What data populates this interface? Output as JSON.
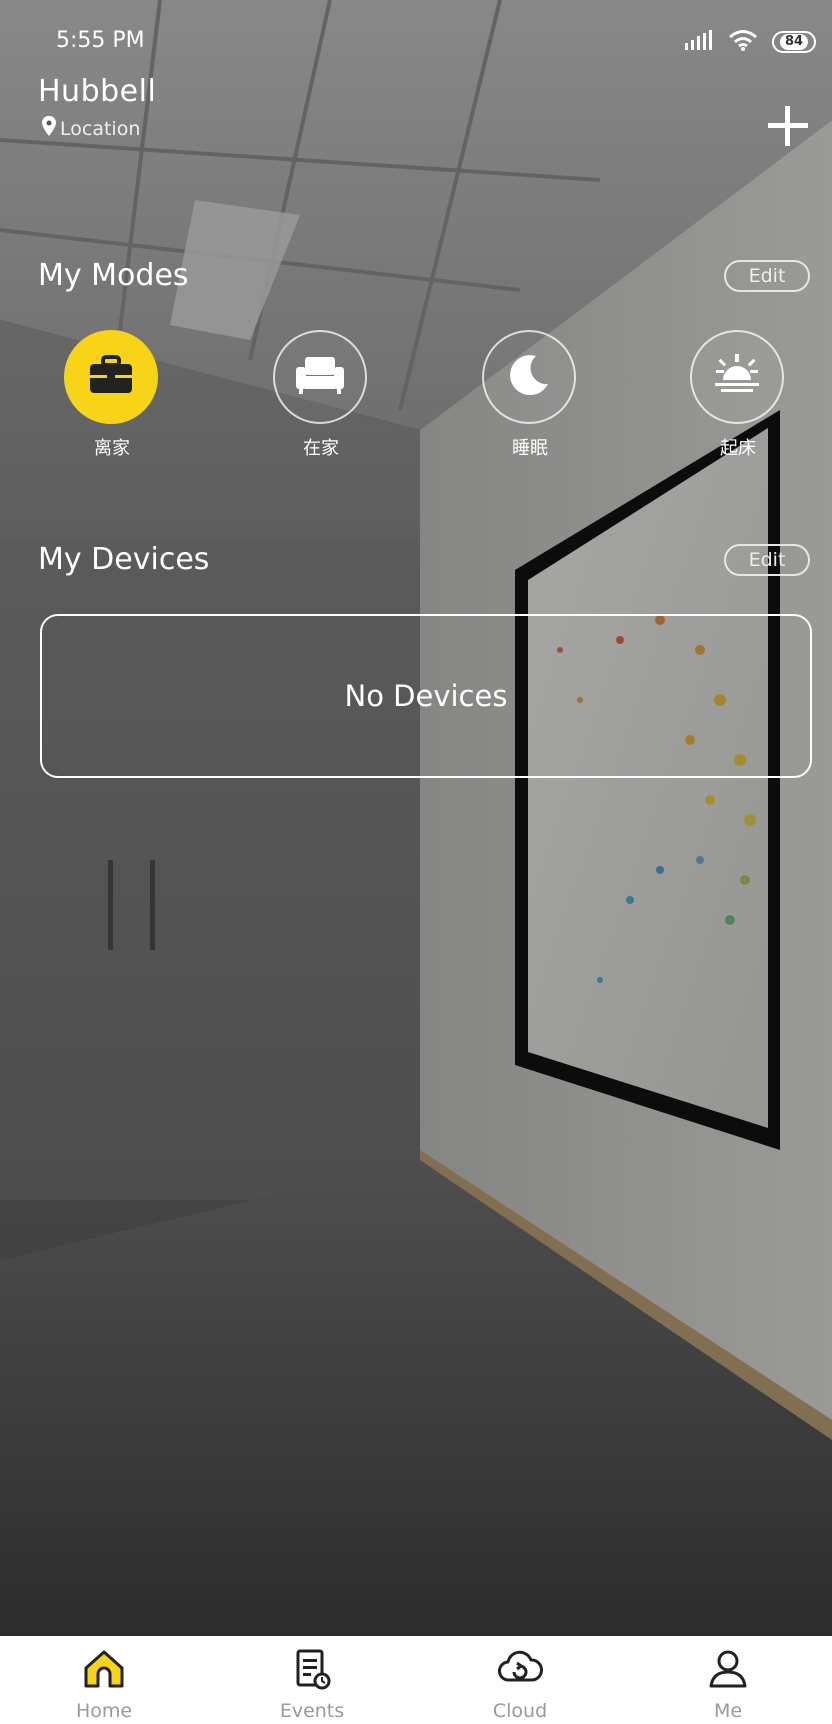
{
  "status": {
    "time": "5:55 PM",
    "battery": "84",
    "icons": [
      "signal-icon",
      "wifi-icon",
      "battery-icon"
    ]
  },
  "header": {
    "title": "Hubbell",
    "location_label": "Location",
    "add_icon": "plus-icon"
  },
  "modes": {
    "title": "My Modes",
    "edit_label": "Edit",
    "items": [
      {
        "label": "离家",
        "icon": "briefcase-icon",
        "active": true
      },
      {
        "label": "在家",
        "icon": "sofa-icon",
        "active": false
      },
      {
        "label": "睡眠",
        "icon": "moon-icon",
        "active": false
      },
      {
        "label": "起床",
        "icon": "sunrise-icon",
        "active": false
      }
    ]
  },
  "devices": {
    "title": "My Devices",
    "edit_label": "Edit",
    "empty_text": "No Devices"
  },
  "nav": {
    "items": [
      {
        "label": "Home",
        "icon": "home-icon",
        "active": true
      },
      {
        "label": "Events",
        "icon": "events-icon",
        "active": false
      },
      {
        "label": "Cloud",
        "icon": "cloud-icon",
        "active": false
      },
      {
        "label": "Me",
        "icon": "user-icon",
        "active": false
      }
    ]
  },
  "colors": {
    "accent": "#f7d417",
    "nav_inactive": "#9a9a9a",
    "nav_background": "#ffffff"
  }
}
